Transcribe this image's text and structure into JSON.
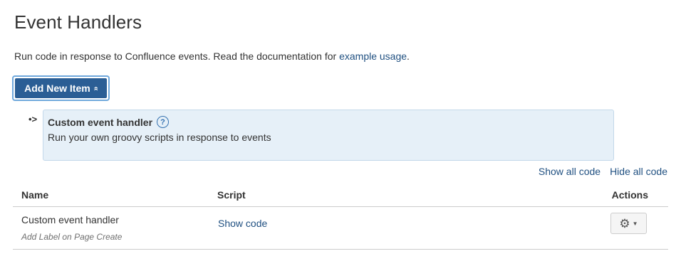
{
  "page": {
    "title": "Event Handlers",
    "intro_text": "Run code in response to Confluence events. Read the documentation for ",
    "intro_link": "example usage",
    "intro_end": "."
  },
  "add_button": {
    "label": "Add New Item",
    "icon": "double-chevron-up-icon",
    "chevron": "«"
  },
  "new_item": {
    "arrow": "•>",
    "title": "Custom event handler",
    "help_icon": "?",
    "description": "Run your own groovy scripts in response to events"
  },
  "code_links": {
    "show_all": "Show all code",
    "hide_all": "Hide all code"
  },
  "table": {
    "headers": {
      "name": "Name",
      "script": "Script",
      "actions": "Actions"
    },
    "rows": [
      {
        "name": "Custom event handler",
        "label": "Add Label on Page Create",
        "script_link": "Show code",
        "actions_icon": "gear-icon"
      }
    ]
  },
  "glyphs": {
    "gear": "⚙",
    "caret": "▼"
  },
  "colors": {
    "primary_button": "#2b5e95",
    "link": "#205081",
    "panel_bg": "#e6f0f8"
  }
}
